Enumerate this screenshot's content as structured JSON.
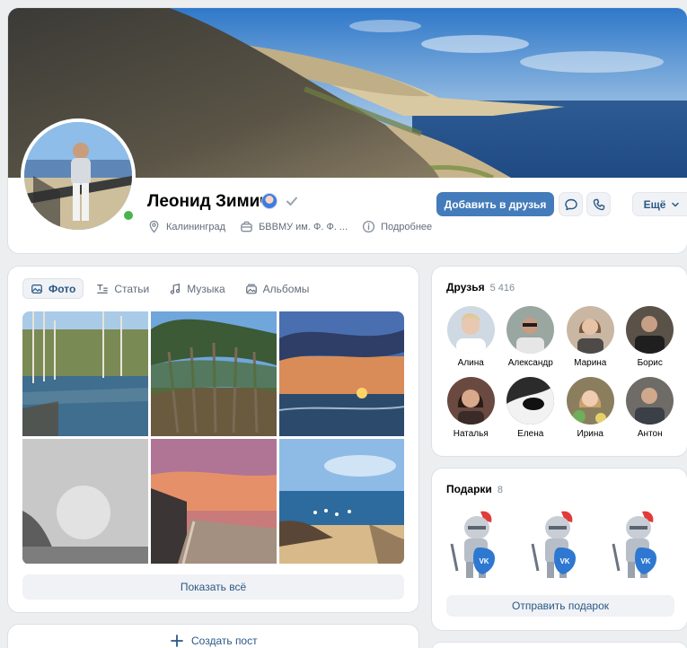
{
  "profile": {
    "name": "Леонид Зимич",
    "city": "Калининград",
    "education": "БВВМУ им. Ф. Ф. ...",
    "details_label": "Подробнее",
    "online": true
  },
  "actions": {
    "add_friend": "Добавить в друзья",
    "more": "Ещё"
  },
  "media": {
    "tabs": [
      {
        "label": "Фото",
        "icon": "photo-icon",
        "active": true
      },
      {
        "label": "Статьи",
        "icon": "articles-icon",
        "active": false
      },
      {
        "label": "Музыка",
        "icon": "music-icon",
        "active": false
      },
      {
        "label": "Альбомы",
        "icon": "albums-icon",
        "active": false
      }
    ],
    "photos": [
      {
        "subject": "forest lake reflection"
      },
      {
        "subject": "pine forest"
      },
      {
        "subject": "sunset over sea"
      },
      {
        "subject": "foggy shore"
      },
      {
        "subject": "pink sunset promenade"
      },
      {
        "subject": "beach with swans"
      }
    ],
    "show_all": "Показать всё"
  },
  "create_post": "Создать пост",
  "friends": {
    "title": "Друзья",
    "count": "5 416",
    "items": [
      {
        "name": "Алина",
        "color": "#cfd9e3"
      },
      {
        "name": "Александр",
        "color": "#9aa6a0"
      },
      {
        "name": "Марина",
        "color": "#c9b7a4"
      },
      {
        "name": "Борис",
        "color": "#5a5148"
      },
      {
        "name": "Наталья",
        "color": "#6a4a40"
      },
      {
        "name": "Елена",
        "color": "#2b2b2b"
      },
      {
        "name": "Ирина",
        "color": "#8a7e5f"
      },
      {
        "name": "Антон",
        "color": "#6f6b67"
      }
    ]
  },
  "gifts": {
    "title": "Подарки",
    "count": "8",
    "send": "Отправить подарок",
    "badge_text": "VK"
  },
  "colors": {
    "accent": "#447bba",
    "link": "#2a5885",
    "online": "#4bb34b"
  }
}
